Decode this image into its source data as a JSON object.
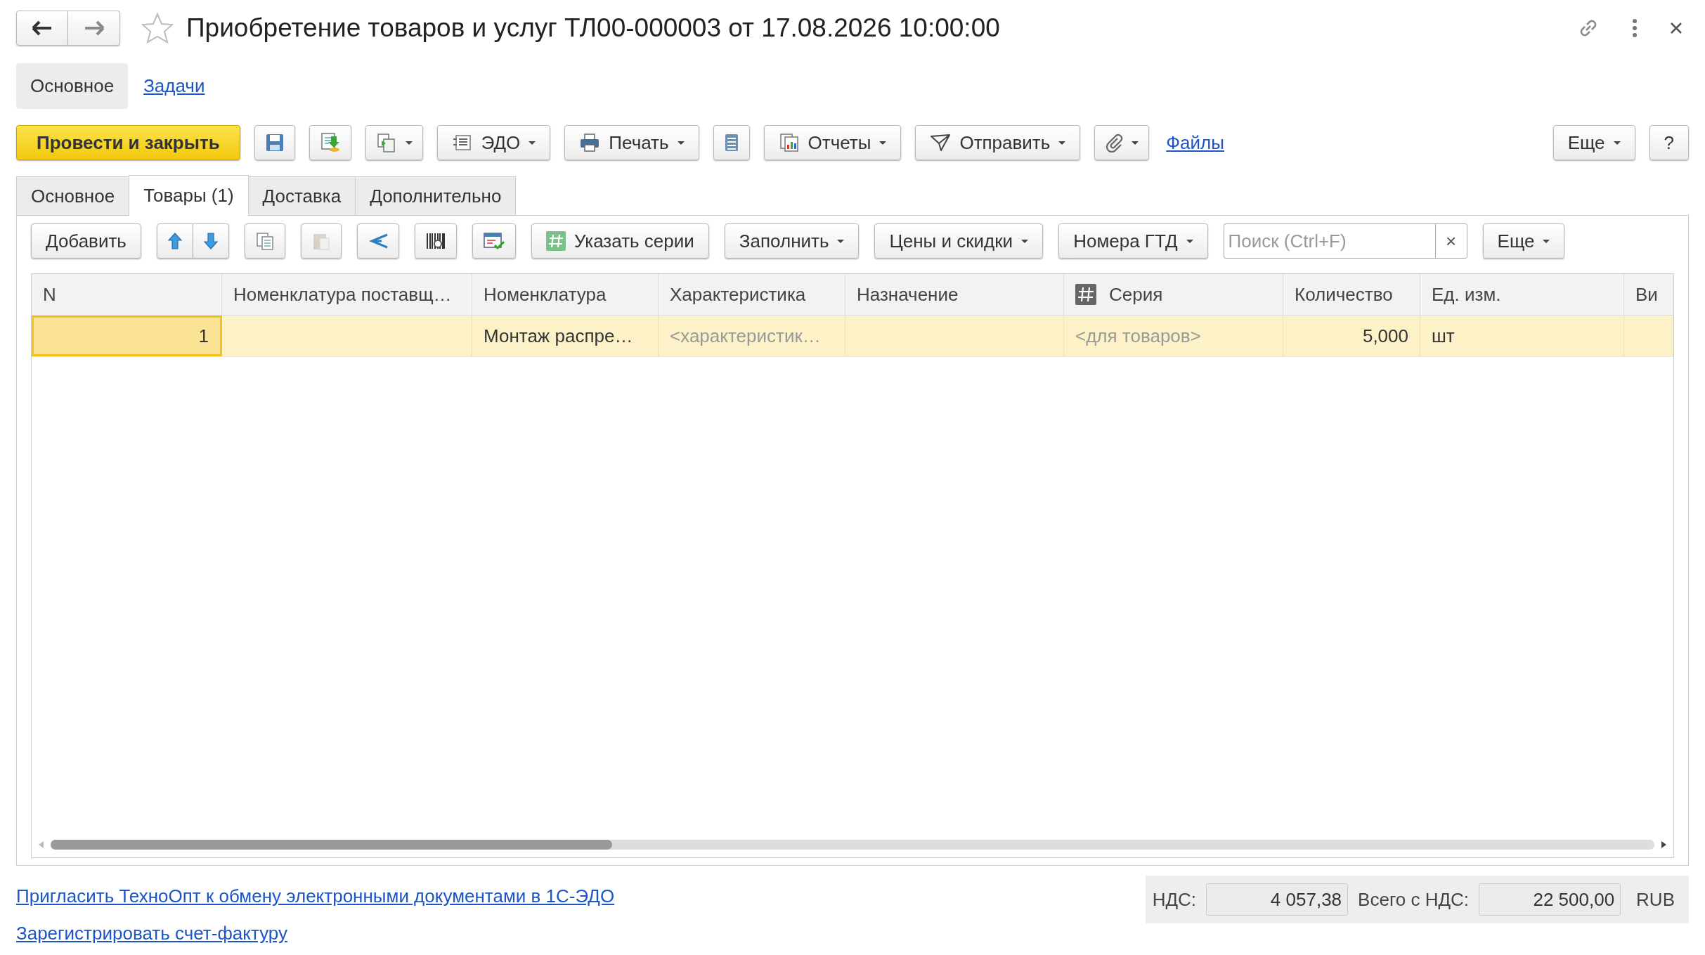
{
  "window": {
    "title": "Приобретение товаров и услуг ТЛ00-000003 от 17.08.2026 10:00:00"
  },
  "sections": [
    {
      "label": "Основное",
      "selected": true
    },
    {
      "label": "Задачи",
      "selected": false
    }
  ],
  "toolbar": {
    "left": [
      {
        "kind": "primary",
        "label": "Провести и закрыть"
      },
      {
        "kind": "icon",
        "dropdown": false
      },
      {
        "kind": "icon",
        "dropdown": false
      },
      {
        "kind": "icon",
        "dropdown": true
      },
      {
        "kind": "button",
        "label": "ЭДО",
        "dropdown": true
      },
      {
        "kind": "button",
        "label": "Печать",
        "dropdown": true
      },
      {
        "kind": "icon",
        "dropdown": false
      },
      {
        "kind": "button",
        "label": "Отчеты",
        "dropdown": true
      },
      {
        "kind": "button",
        "label": "Отправить",
        "dropdown": true
      },
      {
        "kind": "icon",
        "dropdown": true
      },
      {
        "kind": "link",
        "label": "Файлы"
      }
    ],
    "right": [
      {
        "kind": "button",
        "label": "Еще",
        "dropdown": true
      },
      {
        "kind": "button",
        "label": "?",
        "dropdown": false
      }
    ]
  },
  "tabs": [
    {
      "label": "Основное",
      "selected": false
    },
    {
      "label": "Товары (1)",
      "selected": true
    },
    {
      "label": "Доставка",
      "selected": false
    },
    {
      "label": "Дополнительно",
      "selected": false
    }
  ],
  "table_toolbar": {
    "items": [
      {
        "kind": "button",
        "label": "Добавить",
        "dropdown": false
      },
      {
        "kind": "pair"
      },
      {
        "kind": "icon",
        "disabled": false
      },
      {
        "kind": "icon",
        "disabled": true
      },
      {
        "kind": "icon",
        "disabled": false
      },
      {
        "kind": "icon",
        "disabled": false
      },
      {
        "kind": "icon",
        "disabled": false
      },
      {
        "kind": "button",
        "label": "Указать серии",
        "dropdown": false
      },
      {
        "kind": "button",
        "label": "Заполнить",
        "dropdown": true
      },
      {
        "kind": "button",
        "label": "Цены и скидки",
        "dropdown": true
      },
      {
        "kind": "button",
        "label": "Номера ГТД",
        "dropdown": true
      }
    ],
    "search": {
      "placeholder": "Поиск (Ctrl+F)",
      "clear": "×"
    },
    "more": {
      "label": "Еще",
      "dropdown": true
    }
  },
  "table": {
    "columns": [
      {
        "label": "N",
        "kind": "number"
      },
      {
        "label": "Номенклатура поставщ…",
        "kind": "text"
      },
      {
        "label": "Номенклатура",
        "kind": "text"
      },
      {
        "label": "Характеристика",
        "kind": "text"
      },
      {
        "label": "Назначение",
        "kind": "text"
      },
      {
        "label": "Серия",
        "kind": "marked"
      },
      {
        "label": "Количество",
        "kind": "number"
      },
      {
        "label": "Ед. изм.",
        "kind": "text"
      },
      {
        "label": "Ви",
        "kind": "text"
      }
    ],
    "rows": [
      {
        "selected": true,
        "cells": [
          {
            "text": "1",
            "focused": true,
            "placeholder": false
          },
          {
            "focused": false
          },
          {
            "text": "Монтаж распре…",
            "focused": false,
            "placeholder": false
          },
          {
            "text": "<характеристик…",
            "focused": false,
            "placeholder": true
          },
          {
            "focused": false
          },
          {
            "text": "<для товаров>",
            "focused": false,
            "placeholder": true
          },
          {
            "text": "5,000",
            "focused": false,
            "placeholder": false
          },
          {
            "text": "шт",
            "focused": false,
            "placeholder": false
          },
          {
            "focused": false
          }
        ]
      }
    ]
  },
  "footer": {
    "links": [
      "Пригласить ТехноОпт к обмену электронными документами в 1С-ЭДО",
      "Зарегистрировать счет-фактуру"
    ],
    "totals": [
      {
        "label": "НДС:",
        "value": "4 057,38"
      },
      {
        "label": "Всего с НДС:",
        "value": "22 500,00"
      }
    ],
    "currency": "RUB"
  }
}
